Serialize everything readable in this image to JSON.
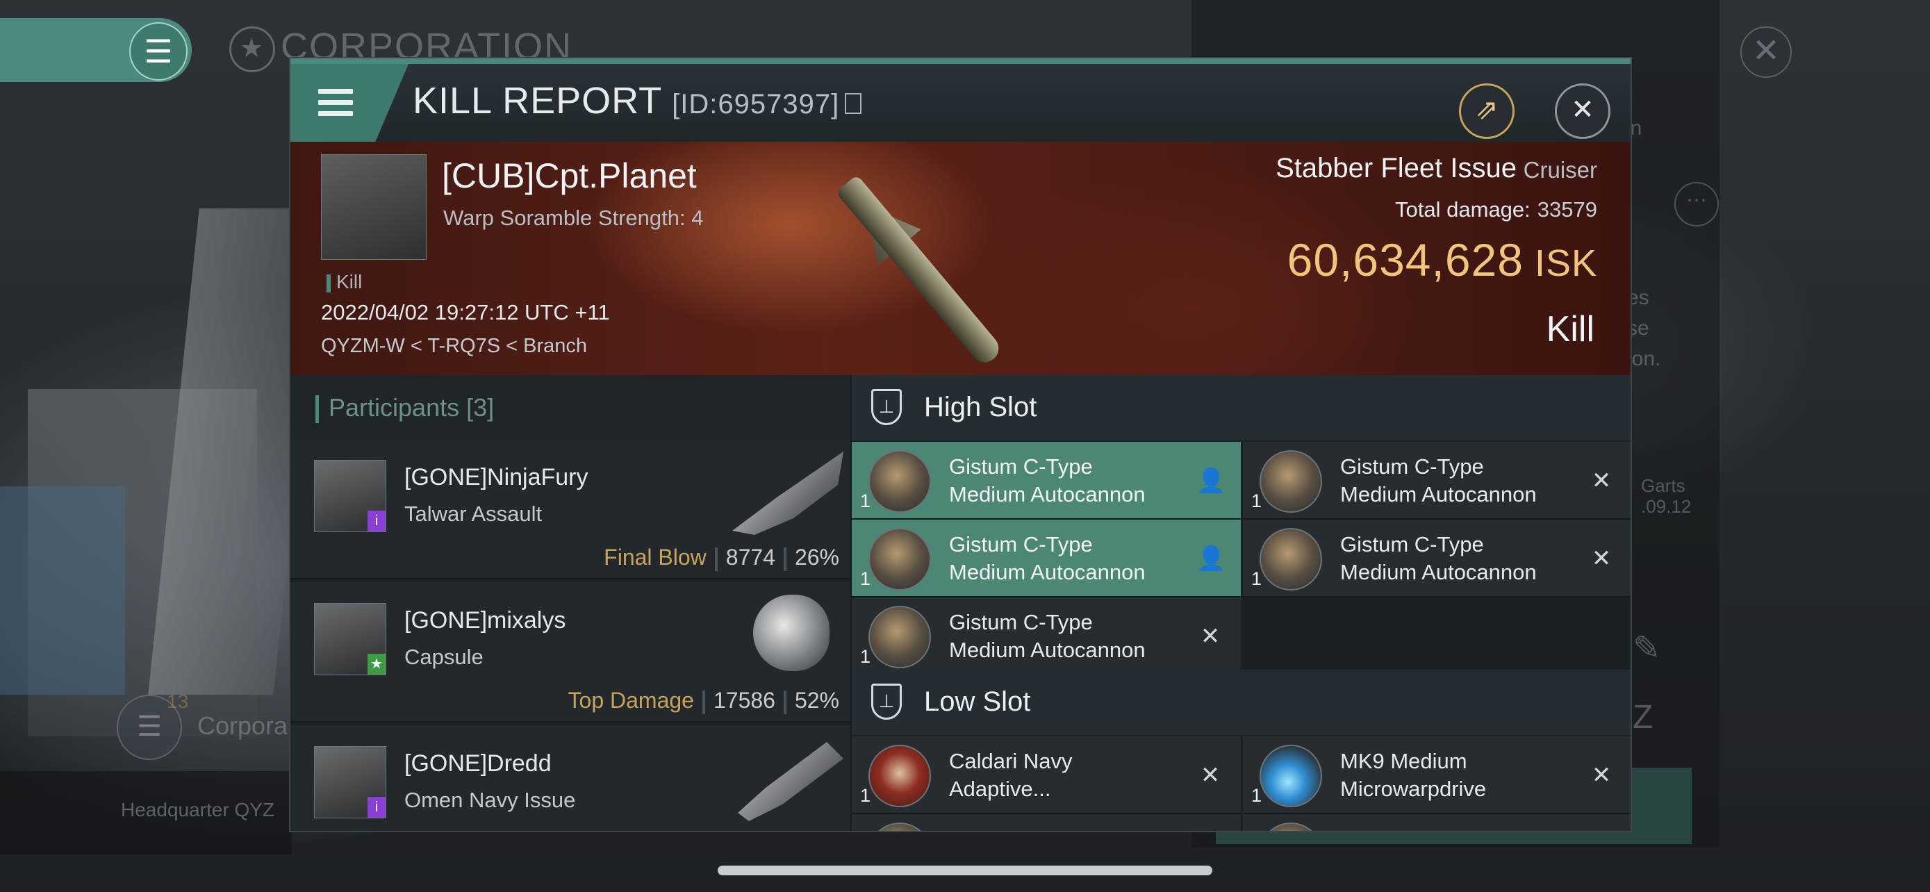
{
  "background": {
    "corp_title": "CORPORATION",
    "corp_button_label": "Corpora",
    "corp_button_badge": "13",
    "hq_label": "Headquarter QYZ",
    "right_fragments": [
      "en",
      "es",
      "se",
      "ion.",
      "Garts",
      ".09.12"
    ]
  },
  "modal": {
    "title": "KILL REPORT",
    "report_id": "[ID:6957397]",
    "victim": {
      "name": "[CUB]Cpt.Planet",
      "subtitle": "Warp Soramble Strength: 4",
      "kill_tag": "Kill",
      "datetime": "2022/04/02 19:27:12 UTC +11",
      "location": "QYZM-W < T-RQ7S < Branch",
      "ship_name": "Stabber Fleet Issue",
      "ship_class": "Cruiser",
      "total_damage_label": "Total damage:",
      "total_damage": "33579",
      "isk_value": "60,634,628",
      "isk_unit": "ISK",
      "report_type": "Kill"
    },
    "participants": {
      "label": "Participants",
      "count": "[3]",
      "items": [
        {
          "name": "[GONE]NinjaFury",
          "ship": "Talwar Assault",
          "tag": "Final Blow",
          "damage": "8774",
          "percent": "26%"
        },
        {
          "name": "[GONE]mixalys",
          "ship": "Capsule",
          "tag": "Top Damage",
          "damage": "17586",
          "percent": "52%"
        },
        {
          "name": "[GONE]Dredd",
          "ship": "Omen Navy Issue",
          "tag": "",
          "damage": "",
          "percent": ""
        }
      ]
    },
    "fittings": {
      "high_slot_label": "High Slot",
      "low_slot_label": "Low Slot",
      "high": [
        {
          "qty": "1",
          "line1": "Gistum C-Type",
          "line2": "Medium Autocannon"
        },
        {
          "qty": "1",
          "line1": "Gistum C-Type",
          "line2": "Medium Autocannon"
        },
        {
          "qty": "1",
          "line1": "Gistum C-Type",
          "line2": "Medium Autocannon"
        },
        {
          "qty": "1",
          "line1": "Gistum C-Type",
          "line2": "Medium Autocannon"
        },
        {
          "qty": "1",
          "line1": "Gistum C-Type",
          "line2": "Medium Autocannon"
        }
      ],
      "low": [
        {
          "qty": "1",
          "line1": "Caldari Navy",
          "line2": "Adaptive..."
        },
        {
          "qty": "1",
          "line1": "MK9 Medium",
          "line2": "Microwarpdrive"
        }
      ]
    }
  }
}
